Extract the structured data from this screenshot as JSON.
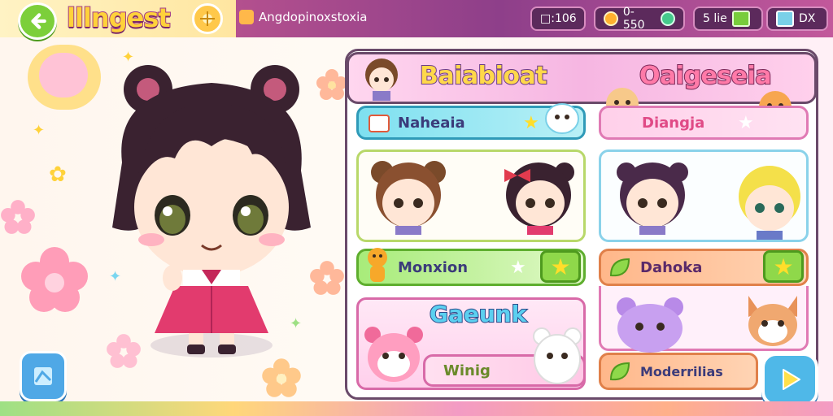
{
  "header": {
    "title": "lllngest",
    "breadcrumb": "Angdopinoxstoxia",
    "stats": [
      {
        "icon": "timer-icon",
        "value": "□:106"
      },
      {
        "icon": "coin-icon",
        "value": "0-550"
      },
      {
        "icon": "gem-icon",
        "value": ""
      },
      {
        "icon": "box-icon",
        "value": "5 lie"
      },
      {
        "icon": "flag-icon",
        "value": "DX"
      }
    ]
  },
  "panel": {
    "left_title": "Baiabioat",
    "right_title": "Oaigeseia",
    "buttons": {
      "top_left": "Naheaia",
      "top_right": "Diangja",
      "mid_left": "Monxion",
      "mid_right": "Dahoka",
      "bottom_title": "Gaeunk",
      "bottom_left": "Winig",
      "bottom_right": "Moderrilias"
    }
  },
  "colors": {
    "accent_pink": "#f6b6e2",
    "accent_green": "#8fd84a",
    "accent_blue": "#4fb8e8",
    "title_yellow": "#ffd23a"
  }
}
